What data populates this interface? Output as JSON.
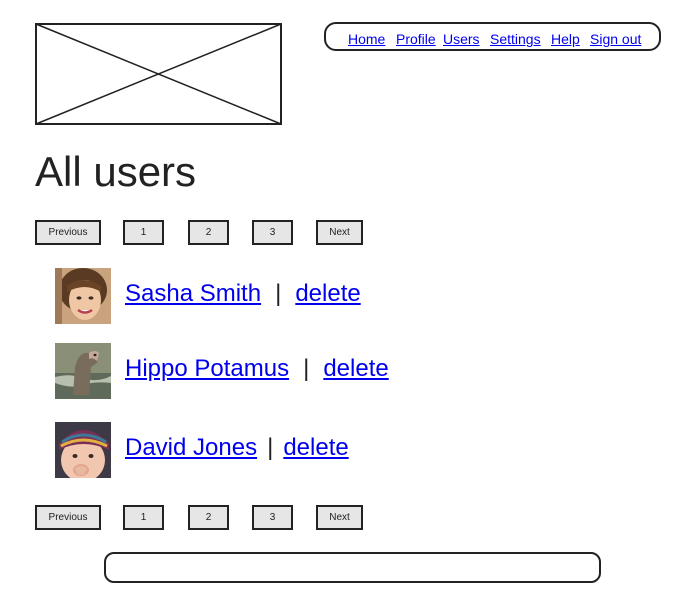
{
  "header": {
    "logo_icon": "image-placeholder-icon",
    "nav": [
      "Home",
      "Profile",
      "Users",
      "Settings",
      "Help",
      "Sign out"
    ]
  },
  "page": {
    "title": "All users"
  },
  "pagination": {
    "previous_label": "Previous",
    "pages": [
      "1",
      "2",
      "3"
    ],
    "next_label": "Next"
  },
  "users": [
    {
      "name": "Sasha Smith",
      "separator": "|",
      "action": "delete",
      "avatar_icon": "woman-face-avatar"
    },
    {
      "name": "Hippo Potamus",
      "separator": "|",
      "action": "delete",
      "avatar_icon": "hippo-avatar"
    },
    {
      "name": "David Jones",
      "separator": "|",
      "action": "delete",
      "avatar_icon": "child-face-avatar"
    }
  ],
  "footer": {
    "text": ""
  },
  "colors": {
    "link": "#0000ee",
    "button_bg": "#e6e6e6",
    "border": "#222222"
  }
}
